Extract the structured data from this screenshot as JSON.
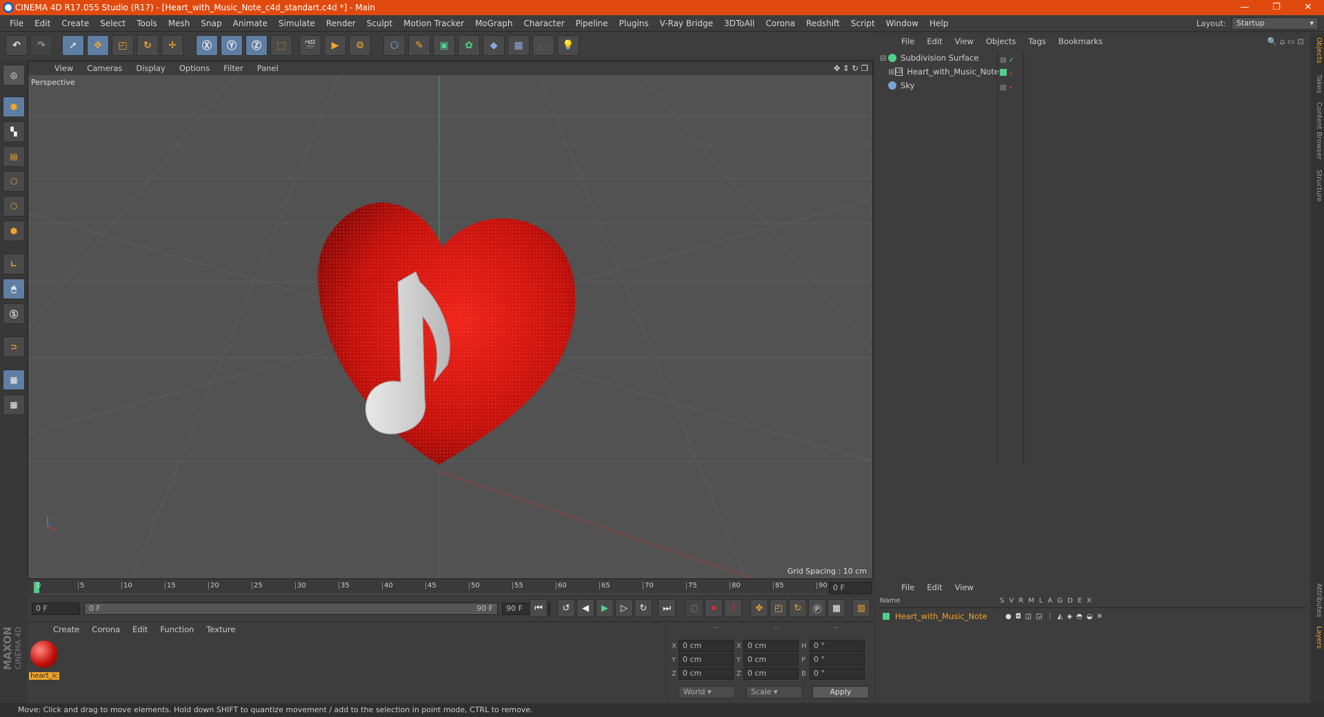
{
  "titlebar": {
    "title": "CINEMA 4D R17.055 Studio (R17) - [Heart_with_Music_Note_c4d_standart.c4d *] - Main",
    "min": "—",
    "max": "❐",
    "close": "✕"
  },
  "menubar": [
    "File",
    "Edit",
    "Create",
    "Select",
    "Tools",
    "Mesh",
    "Snap",
    "Animate",
    "Simulate",
    "Render",
    "Sculpt",
    "Motion Tracker",
    "MoGraph",
    "Character",
    "Pipeline",
    "Plugins",
    "V-Ray Bridge",
    "3DToAll",
    "Corona",
    "Redshift",
    "Script",
    "Window",
    "Help"
  ],
  "layout": {
    "label": "Layout:",
    "value": "Startup"
  },
  "viewport": {
    "menu": [
      "View",
      "Cameras",
      "Display",
      "Options",
      "Filter",
      "Panel"
    ],
    "camera_label": "Perspective",
    "grid_spacing": "Grid Spacing : 10 cm"
  },
  "timeline": {
    "ticks": [
      "0",
      "5",
      "10",
      "15",
      "20",
      "25",
      "30",
      "35",
      "40",
      "45",
      "50",
      "55",
      "60",
      "65",
      "70",
      "75",
      "80",
      "85",
      "90"
    ],
    "frame_field": "0 F"
  },
  "transport": {
    "start": "0 F",
    "range_start": "0 F",
    "range_end": "90 F",
    "end": "90 F"
  },
  "materials": {
    "menu": [
      "Create",
      "Corona",
      "Edit",
      "Function",
      "Texture"
    ],
    "items": [
      {
        "label": "heart_ic"
      }
    ]
  },
  "coords": {
    "headers": [
      "--",
      "--",
      "--"
    ],
    "rows": [
      {
        "a": "X",
        "av": "0 cm",
        "b": "X",
        "bv": "0 cm",
        "c": "H",
        "cv": "0 °"
      },
      {
        "a": "Y",
        "av": "0 cm",
        "b": "Y",
        "bv": "0 cm",
        "c": "P",
        "cv": "0 °"
      },
      {
        "a": "Z",
        "av": "0 cm",
        "b": "Z",
        "bv": "0 cm",
        "c": "B",
        "cv": "0 °"
      }
    ],
    "world": "World",
    "scale": "Scale",
    "apply": "Apply"
  },
  "objects": {
    "menu": [
      "File",
      "Edit",
      "View",
      "Objects",
      "Tags",
      "Bookmarks"
    ],
    "items": [
      {
        "name": "Subdivision Surface"
      },
      {
        "name": "Heart_with_Music_Note"
      },
      {
        "name": "Sky"
      }
    ]
  },
  "layers": {
    "menu": [
      "File",
      "Edit",
      "View"
    ],
    "header": {
      "name": "Name",
      "cols": [
        "S",
        "V",
        "R",
        "M",
        "L",
        "A",
        "G",
        "D",
        "E",
        "X"
      ]
    },
    "row": "Heart_with_Music_Note"
  },
  "rightstrip": [
    "Objects",
    "Takes",
    "Content Browser",
    "Structure",
    "Attributes",
    "Layers"
  ],
  "status": "Move: Click and drag to move elements. Hold down SHIFT to quantize movement / add to the selection in point mode, CTRL to remove.",
  "brand": {
    "maxon": "MAXON",
    "cinema": "CINEMA 4D"
  },
  "colors": {
    "title": "#e04a0f",
    "accent": "#5f7ea3",
    "heart": "#d2140e",
    "layer_green": "#5fdc8a"
  }
}
